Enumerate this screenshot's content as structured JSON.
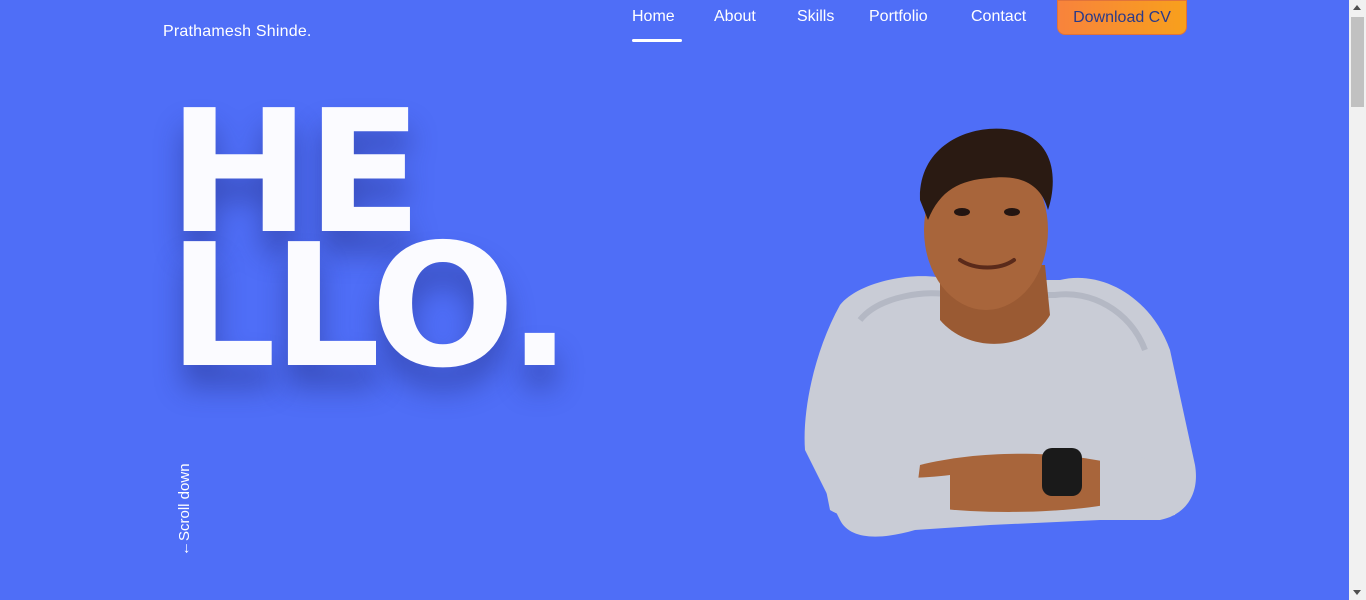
{
  "header": {
    "brand": "Prathamesh Shinde.",
    "nav": [
      "Home",
      "About",
      "Skills",
      "Portfolio",
      "Contact"
    ],
    "active_nav": "Home",
    "cta": "Download CV"
  },
  "hero": {
    "line1": "HE",
    "line2": "LLO.",
    "scroll_hint": "←Scroll down"
  },
  "colors": {
    "background": "#4f6ef7",
    "accent": "#f8833c",
    "text": "#ffffff"
  }
}
